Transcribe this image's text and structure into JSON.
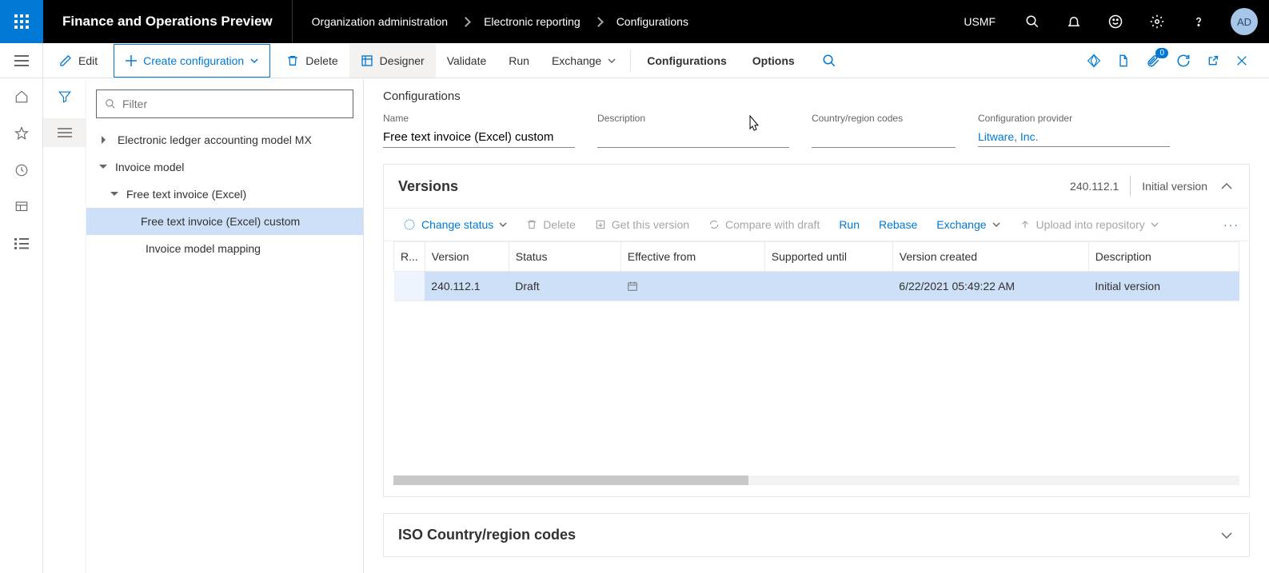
{
  "header": {
    "title": "Finance and Operations Preview",
    "breadcrumb": [
      "Organization administration",
      "Electronic reporting",
      "Configurations"
    ],
    "company": "USMF",
    "avatar": "AD",
    "badges": {
      "attachments": "0"
    }
  },
  "toolbar": {
    "edit": "Edit",
    "create": "Create configuration",
    "delete": "Delete",
    "designer": "Designer",
    "validate": "Validate",
    "run": "Run",
    "exchange": "Exchange",
    "tabs": {
      "configurations": "Configurations",
      "options": "Options"
    }
  },
  "filter": {
    "placeholder": "Filter"
  },
  "tree": {
    "n0": "Electronic ledger accounting model MX",
    "n1": "Invoice model",
    "n2": "Free text invoice (Excel)",
    "n3": "Free text invoice (Excel) custom",
    "n4": "Invoice model mapping"
  },
  "details": {
    "section": "Configurations",
    "labels": {
      "name": "Name",
      "description": "Description",
      "country": "Country/region codes",
      "provider": "Configuration provider"
    },
    "name": "Free text invoice (Excel) custom",
    "description": "",
    "country": "",
    "provider": "Litware, Inc."
  },
  "versions": {
    "title": "Versions",
    "current": "240.112.1",
    "current_desc": "Initial version",
    "toolbar": {
      "change_status": "Change status",
      "delete": "Delete",
      "get": "Get this version",
      "compare": "Compare with draft",
      "run": "Run",
      "rebase": "Rebase",
      "exchange": "Exchange",
      "upload": "Upload into repository"
    },
    "cols": {
      "r": "R...",
      "version": "Version",
      "status": "Status",
      "eff": "Effective from",
      "supp": "Supported until",
      "created": "Version created",
      "desc": "Description"
    },
    "rows": [
      {
        "version": "240.112.1",
        "status": "Draft",
        "eff": "",
        "supp": "",
        "created": "6/22/2021 05:49:22 AM",
        "desc": "Initial version"
      }
    ]
  },
  "iso": {
    "title": "ISO Country/region codes"
  }
}
